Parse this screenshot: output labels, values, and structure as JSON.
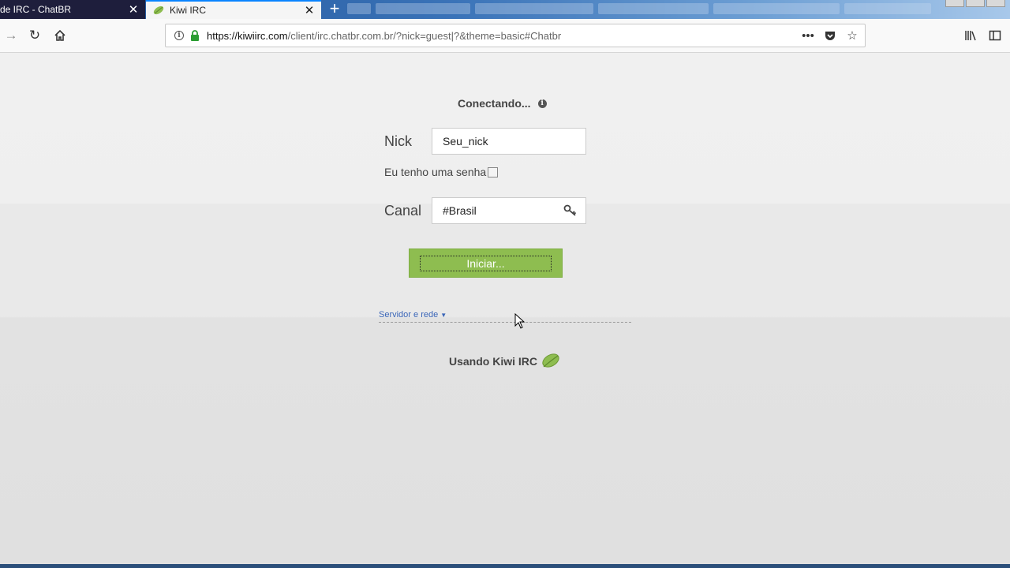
{
  "browser": {
    "tabs": [
      {
        "title": "de IRC - ChatBR",
        "active": false
      },
      {
        "title": "Kiwi IRC",
        "active": true
      }
    ],
    "url": {
      "host": "https://kiwiirc.com",
      "path": "/client/irc.chatbr.com.br/?nick=guest|?&theme=basic#Chatbr"
    },
    "icons": {
      "forward": "forward-arrow-icon",
      "reload": "reload-icon",
      "home": "home-icon",
      "info": "info-icon",
      "lock": "lock-icon",
      "more": "more-icon",
      "pocket": "pocket-icon",
      "bookmark": "star-icon",
      "library": "library-icon",
      "sidebar": "sidebar-icon"
    }
  },
  "login": {
    "status": "Conectando...",
    "nick_label": "Nick",
    "nick_value": "Seu_nick",
    "password_label": "Eu tenho uma senha",
    "password_checked": false,
    "channel_label": "Canal",
    "channel_value": "#Brasil",
    "start_button": "Iniciar...",
    "server_link": "Servidor e rede",
    "powered_by": "Usando Kiwi IRC"
  },
  "colors": {
    "start_button": "#8ebd50",
    "link": "#3b66b8",
    "active_tab_accent": "#0a84ff",
    "lock": "#2a9d32"
  }
}
